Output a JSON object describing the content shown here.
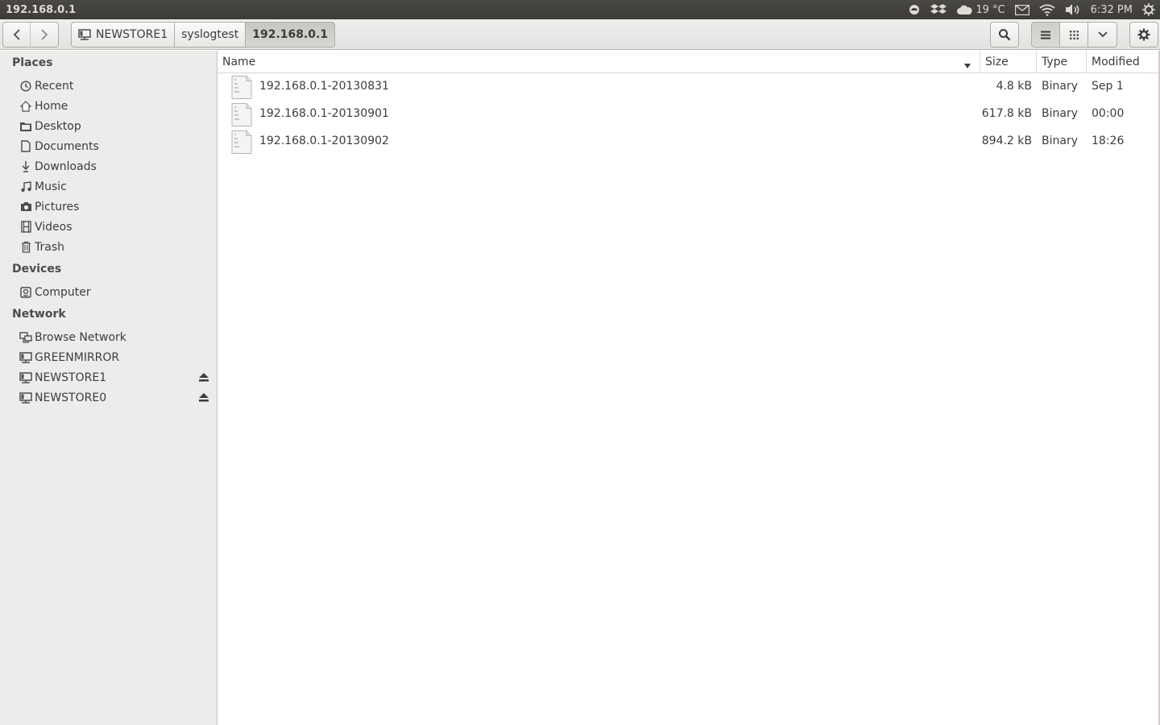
{
  "window": {
    "title": "192.168.0.1"
  },
  "indicators": {
    "weather": "19 °C",
    "time": "6:32 PM"
  },
  "pathbar": [
    {
      "label": "NEWSTORE1",
      "icon": "network-drive-icon"
    },
    {
      "label": "syslogtest"
    },
    {
      "label": "192.168.0.1"
    }
  ],
  "sidebar": {
    "places_header": "Places",
    "places": [
      {
        "label": "Recent",
        "icon": "clock-icon"
      },
      {
        "label": "Home",
        "icon": "home-icon"
      },
      {
        "label": "Desktop",
        "icon": "folder-icon"
      },
      {
        "label": "Documents",
        "icon": "document-icon"
      },
      {
        "label": "Downloads",
        "icon": "download-icon"
      },
      {
        "label": "Music",
        "icon": "music-icon"
      },
      {
        "label": "Pictures",
        "icon": "camera-icon"
      },
      {
        "label": "Videos",
        "icon": "film-icon"
      },
      {
        "label": "Trash",
        "icon": "trash-icon"
      }
    ],
    "devices_header": "Devices",
    "devices": [
      {
        "label": "Computer",
        "icon": "computer-icon"
      }
    ],
    "network_header": "Network",
    "network": [
      {
        "label": "Browse Network",
        "icon": "network-icon"
      },
      {
        "label": "GREENMIRROR",
        "icon": "network-drive-icon"
      },
      {
        "label": "NEWSTORE1",
        "icon": "network-drive-icon",
        "eject": true
      },
      {
        "label": "NEWSTORE0",
        "icon": "network-drive-icon",
        "eject": true
      }
    ]
  },
  "columns": {
    "name": "Name",
    "size": "Size",
    "type": "Type",
    "modified": "Modified"
  },
  "files": [
    {
      "name": "192.168.0.1-20130831",
      "size": "4.8 kB",
      "type": "Binary",
      "modified": "Sep 1"
    },
    {
      "name": "192.168.0.1-20130901",
      "size": "617.8 kB",
      "type": "Binary",
      "modified": "00:00"
    },
    {
      "name": "192.168.0.1-20130902",
      "size": "894.2 kB",
      "type": "Binary",
      "modified": "18:26"
    }
  ]
}
